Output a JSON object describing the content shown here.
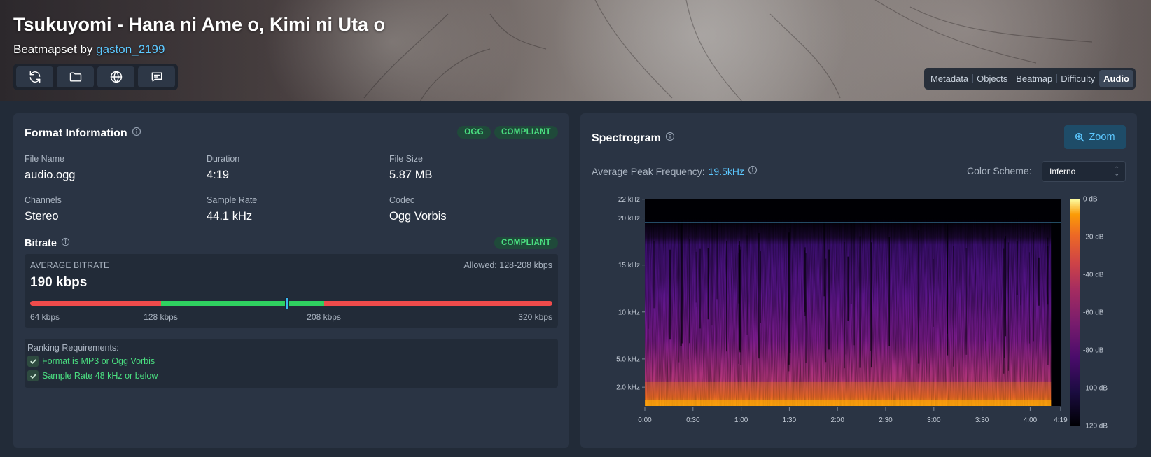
{
  "header": {
    "title": "Tsukuyomi - Hana ni Ame o, Kimi ni Uta o",
    "subtitle_prefix": "Beatmapset by ",
    "creator": "gaston_2199",
    "actions": [
      "refresh-icon",
      "folder-icon",
      "globe-icon",
      "chat-icon"
    ],
    "tabs": [
      "Metadata",
      "Objects",
      "Beatmap",
      "Difficulty",
      "Audio"
    ],
    "active_tab": "Audio"
  },
  "format": {
    "title": "Format Information",
    "badges": [
      "OGG",
      "COMPLIANT"
    ],
    "fields": [
      {
        "label": "File Name",
        "value": "audio.ogg"
      },
      {
        "label": "Duration",
        "value": "4:19"
      },
      {
        "label": "File Size",
        "value": "5.87 MB"
      },
      {
        "label": "Channels",
        "value": "Stereo"
      },
      {
        "label": "Sample Rate",
        "value": "44.1 kHz"
      },
      {
        "label": "Codec",
        "value": "Ogg Vorbis"
      }
    ]
  },
  "bitrate": {
    "title": "Bitrate",
    "badge": "COMPLIANT",
    "average_label": "AVERAGE BITRATE",
    "average_value": "190 kbps",
    "allowed": "Allowed: 128-208 kbps",
    "scale_min": 64,
    "scale_max": 320,
    "allowed_min": 128,
    "allowed_max": 208,
    "current": 190,
    "tick_labels": [
      "64 kbps",
      "128 kbps",
      "208 kbps",
      "320 kbps"
    ]
  },
  "ranking": {
    "title": "Ranking Requirements:",
    "items": [
      "Format is MP3 or Ogg Vorbis",
      "Sample Rate 48 kHz or below"
    ]
  },
  "spectrogram": {
    "title": "Spectrogram",
    "zoom_label": "Zoom",
    "peak_label": "Average Peak Frequency: ",
    "peak_value": "19.5kHz",
    "color_scheme_label": "Color Scheme:",
    "color_scheme": "Inferno",
    "accent": "#5cc8ff"
  },
  "chart_data": {
    "type": "heatmap",
    "title": "Spectrogram",
    "xlabel": "",
    "ylabel": "",
    "x_ticks": [
      "0:00",
      "0:30",
      "1:00",
      "1:30",
      "2:00",
      "2:30",
      "3:00",
      "3:30",
      "4:00",
      "4:19"
    ],
    "x_tick_seconds": [
      0,
      30,
      60,
      90,
      120,
      150,
      180,
      210,
      240,
      259
    ],
    "xlim": [
      0,
      259
    ],
    "y_ticks": [
      "22 kHz",
      "20 kHz",
      "15 kHz",
      "10 kHz",
      "5.0 kHz",
      "2.0 kHz"
    ],
    "y_tick_khz": [
      22,
      20,
      15,
      10,
      5,
      2
    ],
    "ylim": [
      0,
      22.05
    ],
    "peak_line_khz": 19.5,
    "colorbar_ticks": [
      "0 dB",
      "-20 dB",
      "-40 dB",
      "-60 dB",
      "-80 dB",
      "-100 dB",
      "-120 dB"
    ],
    "colorbar_db": [
      0,
      -20,
      -40,
      -60,
      -80,
      -100,
      -120
    ],
    "colormap": "inferno",
    "grid": false
  }
}
